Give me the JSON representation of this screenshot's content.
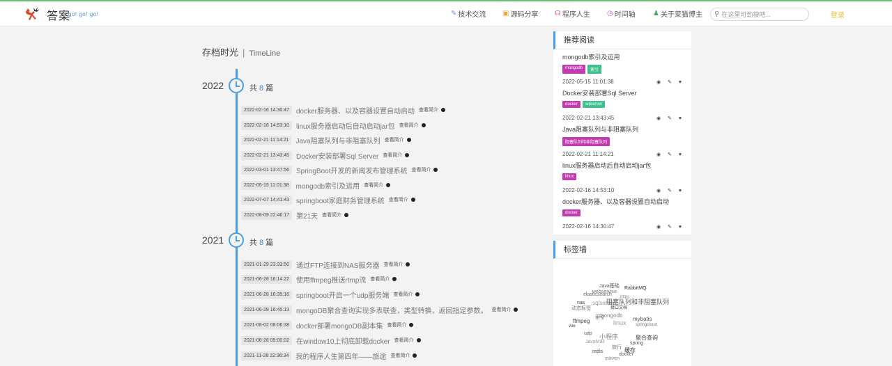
{
  "header": {
    "logo_text": "答案",
    "logo_sub": "go! go! go!",
    "nav": [
      {
        "icon": "✎",
        "label": "技术交流",
        "color": "#6b8cd6"
      },
      {
        "icon": "▣",
        "label": "源码分享",
        "color": "#e8a53a"
      },
      {
        "icon": "☊",
        "label": "程序人生",
        "color": "#e05a5a"
      },
      {
        "icon": "◷",
        "label": "时间轴",
        "color": "#b25ce0"
      },
      {
        "icon": "♟",
        "label": "关于菜猫博主",
        "color": "#3aa86b"
      }
    ],
    "search_placeholder": "在这里可劲搜吧...",
    "login": "登录"
  },
  "timeline": {
    "title": "存档时光",
    "subtitle": "TimeLine",
    "more_label": "查看简介",
    "groups": [
      {
        "year": "2022",
        "count_prefix": "共",
        "count": "8",
        "count_suffix": "篇",
        "entries": [
          {
            "date": "2022-02-16 14:30:47",
            "title": "docker服务器、以及容器设置自动启动"
          },
          {
            "date": "2022-02-16 14:53:10",
            "title": "linux服务器启动后自动启动jar包"
          },
          {
            "date": "2022-02-21 11:14:21",
            "title": "Java阻塞队列与非阻塞队列"
          },
          {
            "date": "2022-02-21 13:43:45",
            "title": "Docker安装部署Sql Server"
          },
          {
            "date": "2022-03-01 13:47:56",
            "title": "SpringBoot开发的新闻发布管理系统"
          },
          {
            "date": "2022-05-15 11:01:38",
            "title": "mongodb索引及运用"
          },
          {
            "date": "2022-07-07 14:41:43",
            "title": "springboot家庭财务管理系统"
          },
          {
            "date": "2022-08-09 22:46:17",
            "title": "第21天"
          }
        ]
      },
      {
        "year": "2021",
        "count_prefix": "共",
        "count": "8",
        "count_suffix": "篇",
        "entries": [
          {
            "date": "2021-01-29 23:33:50",
            "title": "通过FTP连接到NAS服务器"
          },
          {
            "date": "2021-06-28 16:14:22",
            "title": "使用ffmpeg推送rtmp流"
          },
          {
            "date": "2021-06-28 16:35:16",
            "title": "springboot开启一个udp服务端"
          },
          {
            "date": "2021-06-28 16:45:13",
            "title": "mongoDB聚合查询实现多表联查，类型转换，返回指定参数。"
          },
          {
            "date": "2021-08-02 08:06:38",
            "title": "docker部署mongoDB副本集"
          },
          {
            "date": "2021-08-28 09:00:02",
            "title": "在window10上彻底卸载docker"
          },
          {
            "date": "2021-11-28 22:36:34",
            "title": "我的程序人生第四年——旅途"
          }
        ]
      }
    ]
  },
  "recommend": {
    "title": "推荐阅读",
    "items": [
      {
        "title": "mongodb索引及运用",
        "tags": [
          {
            "label": "mongodb",
            "color": "#c43ab0"
          },
          {
            "label": "索引",
            "color": "#3cc18c"
          }
        ],
        "date": "2022-05-15 11:01:38"
      },
      {
        "title": "Docker安装部署Sql Server",
        "tags": [
          {
            "label": "docker",
            "color": "#c43ab0"
          },
          {
            "label": "sqlserver",
            "color": "#3cc18c"
          }
        ],
        "date": "2022-02-21 13:43:45"
      },
      {
        "title": "Java阻塞队列与非阻塞队列",
        "tags": [
          {
            "label": "阻塞队列和非阻塞队列",
            "color": "#c43ab0"
          }
        ],
        "date": "2022-02-21 11:14:21"
      },
      {
        "title": "linux服务器启动后自动启动jar包",
        "tags": [
          {
            "label": "linux",
            "color": "#c43ab0"
          }
        ],
        "date": "2022-02-16 14:53:10"
      },
      {
        "title": "docker服务器、以及容器设置自动启动",
        "tags": [
          {
            "label": "docker",
            "color": "#c43ab0"
          }
        ],
        "date": "2022-02-16 14:30:47"
      }
    ],
    "meta_icons": "◉ ✎ ♥"
  },
  "tagwall": {
    "title": "标签墙",
    "tags": [
      "Java基础",
      "webservice",
      "RabbitMQ",
      "elasticsearch",
      "https",
      "nas",
      "sqlserver",
      "阻塞队列和非阻塞队列",
      "动态标签",
      "接口文档",
      "索引",
      "mongodb",
      "ffmpeg",
      "linux",
      "mybatis",
      "springcloud",
      "vue",
      "udp",
      "小程序",
      "聚合查询",
      "JavaMail",
      "spring",
      "旅行",
      "缓存",
      "docker",
      "maven",
      "redis"
    ]
  }
}
